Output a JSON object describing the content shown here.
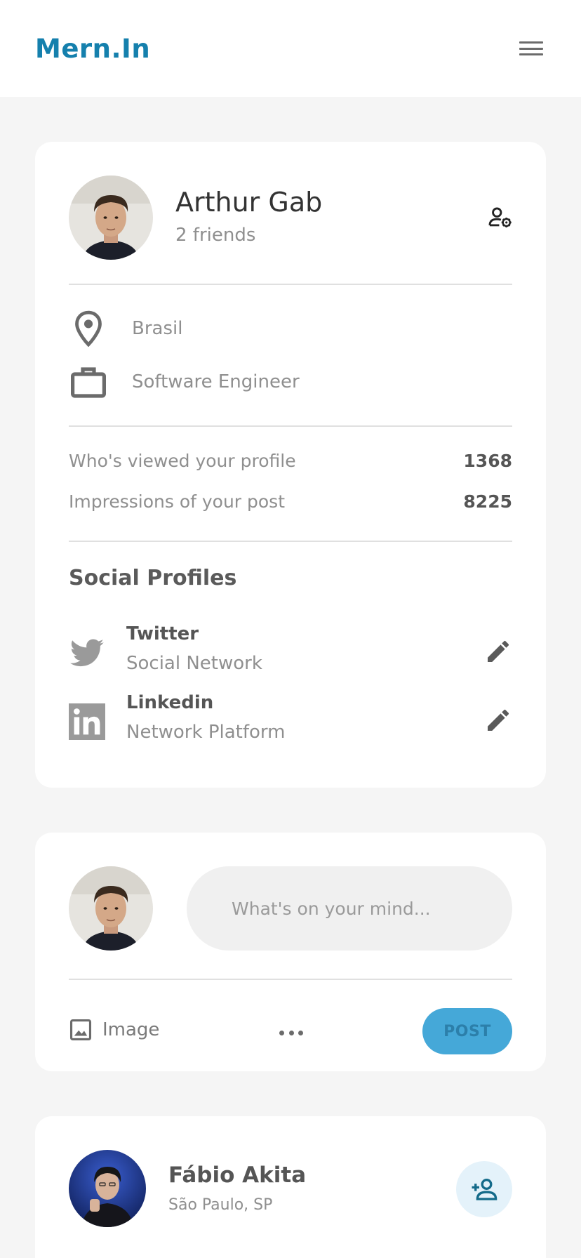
{
  "navbar": {
    "logo": "Mern.In"
  },
  "profile": {
    "name": "Arthur Gab",
    "friends": "2 friends",
    "location": "Brasil",
    "occupation": "Software Engineer",
    "stats": [
      {
        "label": "Who's viewed your profile",
        "value": "1368"
      },
      {
        "label": "Impressions of your post",
        "value": "8225"
      }
    ],
    "social_title": "Social Profiles",
    "socials": [
      {
        "name": "Twitter",
        "sub": "Social Network",
        "icon": "twitter-icon"
      },
      {
        "name": "Linkedin",
        "sub": "Network Platform",
        "icon": "linkedin-icon"
      }
    ]
  },
  "composer": {
    "placeholder": "What's on your mind...",
    "image_label": "Image",
    "post_label": "POST"
  },
  "feed": {
    "friend_name": "Fábio Akita",
    "friend_location": "São Paulo, SP"
  },
  "colors": {
    "brand": "#1580ad",
    "post_button": "#45a8d8",
    "add_friend_bg": "#e4f2fa",
    "background": "#f5f5f5"
  }
}
